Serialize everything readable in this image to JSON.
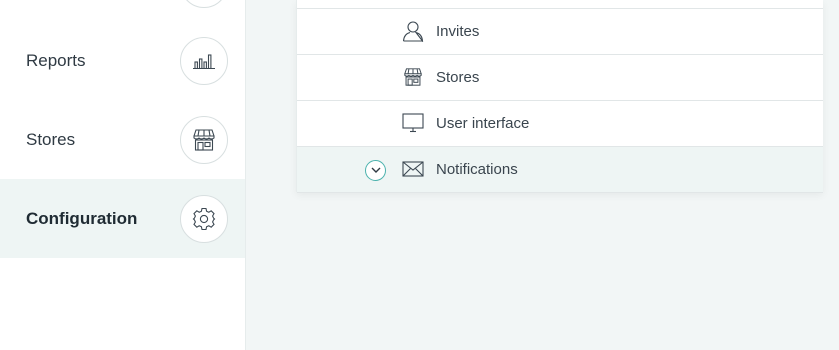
{
  "sidebar": {
    "items": [
      {
        "label": "Reports",
        "icon": "bar-chart-icon"
      },
      {
        "label": "Stores",
        "icon": "store-icon"
      },
      {
        "label": "Configuration",
        "icon": "gear-icon",
        "active": true
      }
    ]
  },
  "panel": {
    "rows": [
      {
        "label": "Invites",
        "icon": "user-icon"
      },
      {
        "label": "Stores",
        "icon": "store-icon"
      },
      {
        "label": "User interface",
        "icon": "monitor-icon"
      },
      {
        "label": "Notifications",
        "icon": "envelope-icon",
        "expandable": true,
        "highlighted": true
      }
    ]
  },
  "colors": {
    "accent": "#4bb2ad",
    "active_bg": "#eef5f4",
    "page_bg": "#f2f6f6"
  }
}
